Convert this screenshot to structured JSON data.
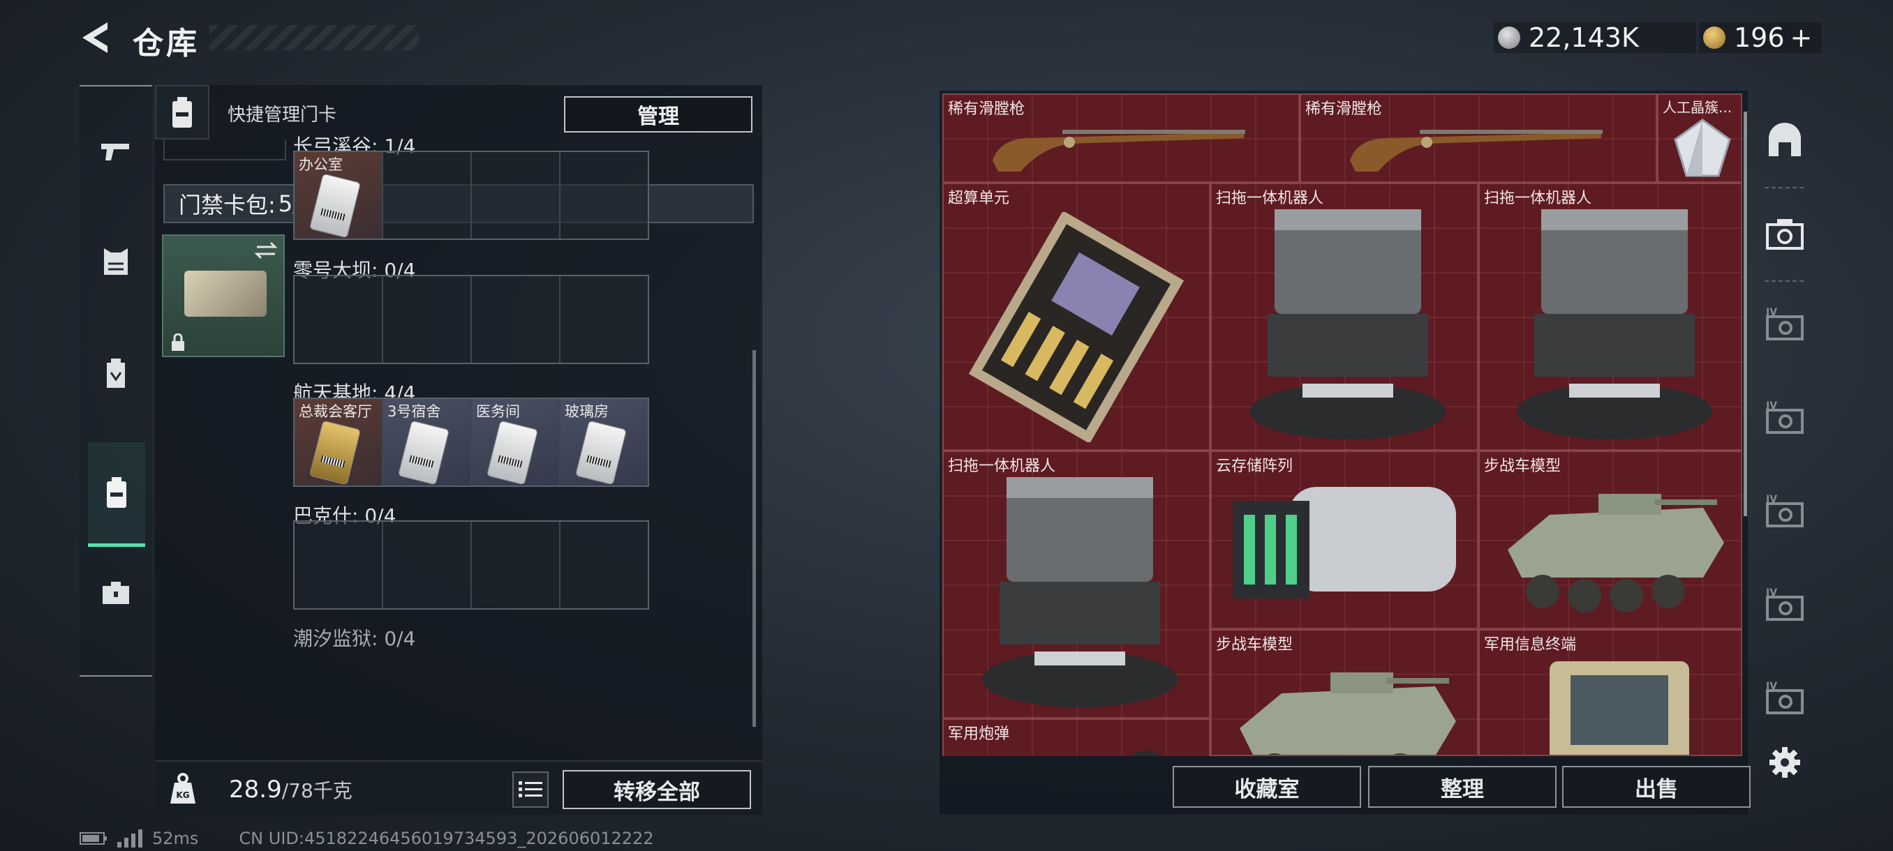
{
  "header": {
    "title": "仓库",
    "currency": {
      "coins": "22,143K",
      "bonds": "196",
      "bonds_plus": "+"
    }
  },
  "left_rail": {
    "items": [
      "gun-icon",
      "armor-icon",
      "backpack-icon",
      "keycard-icon",
      "toolbox-icon"
    ],
    "selected": "keycard-icon"
  },
  "quick_manage": {
    "label": "快捷管理门卡",
    "manage_button": "管理"
  },
  "keycard_bag": {
    "title": "门禁卡包:",
    "count": "5/20",
    "help": "?",
    "zones": [
      {
        "label": "长弓溪谷: 1/4",
        "slots": [
          "办公室",
          "",
          "",
          ""
        ]
      },
      {
        "label": "零号大坝: 0/4",
        "slots": [
          "",
          "",
          "",
          ""
        ]
      },
      {
        "label": "航天基地: 4/4",
        "slots": [
          "总裁会客厅",
          "3号宿舍",
          "医务间",
          "玻璃房"
        ]
      },
      {
        "label": "巴克什: 0/4",
        "slots": [
          "",
          "",
          "",
          ""
        ]
      },
      {
        "label": "潮汐监狱: 0/4",
        "slots": []
      }
    ]
  },
  "weight": {
    "current": "28.9",
    "max": "/78千克"
  },
  "actions_left": {
    "transfer_all": "转移全部"
  },
  "stash": {
    "items": [
      {
        "name": "稀有滑膛枪",
        "icon": "musket-icon"
      },
      {
        "name": "稀有滑膛枪",
        "icon": "musket-icon"
      },
      {
        "name": "人工晶簇...",
        "icon": "crystal-icon"
      },
      {
        "name": "超算单元",
        "icon": "circuit-board-icon"
      },
      {
        "name": "扫拖一体机器人",
        "icon": "robot-vacuum-icon"
      },
      {
        "name": "扫拖一体机器人",
        "icon": "robot-vacuum-icon"
      },
      {
        "name": "扫拖一体机器人",
        "icon": "robot-vacuum-icon"
      },
      {
        "name": "云存储阵列",
        "icon": "storage-array-icon"
      },
      {
        "name": "步战车模型",
        "icon": "ifv-model-icon"
      },
      {
        "name": "步战车模型",
        "icon": "ifv-model-icon"
      },
      {
        "name": "军用信息终端",
        "icon": "terminal-icon"
      },
      {
        "name": "军用炮弹",
        "icon": "shell-icon"
      }
    ]
  },
  "actions_right": {
    "collection": "收藏室",
    "organize": "整理",
    "sell": "出售"
  },
  "right_rail": {
    "items": [
      "vault-icon",
      "case-icon",
      "case-iv-icon",
      "case-iv-icon",
      "case-iv-icon",
      "case-iv-icon",
      "case-iv-icon"
    ],
    "case_level": "IV",
    "settings": "settings-icon"
  },
  "status": {
    "ping": "52ms",
    "uid": "CN UID:45182246456019734593_202606012222"
  },
  "colors": {
    "accent": "#57e0b0",
    "stash_bg": "#5e1b22",
    "panel": "#10161e"
  }
}
